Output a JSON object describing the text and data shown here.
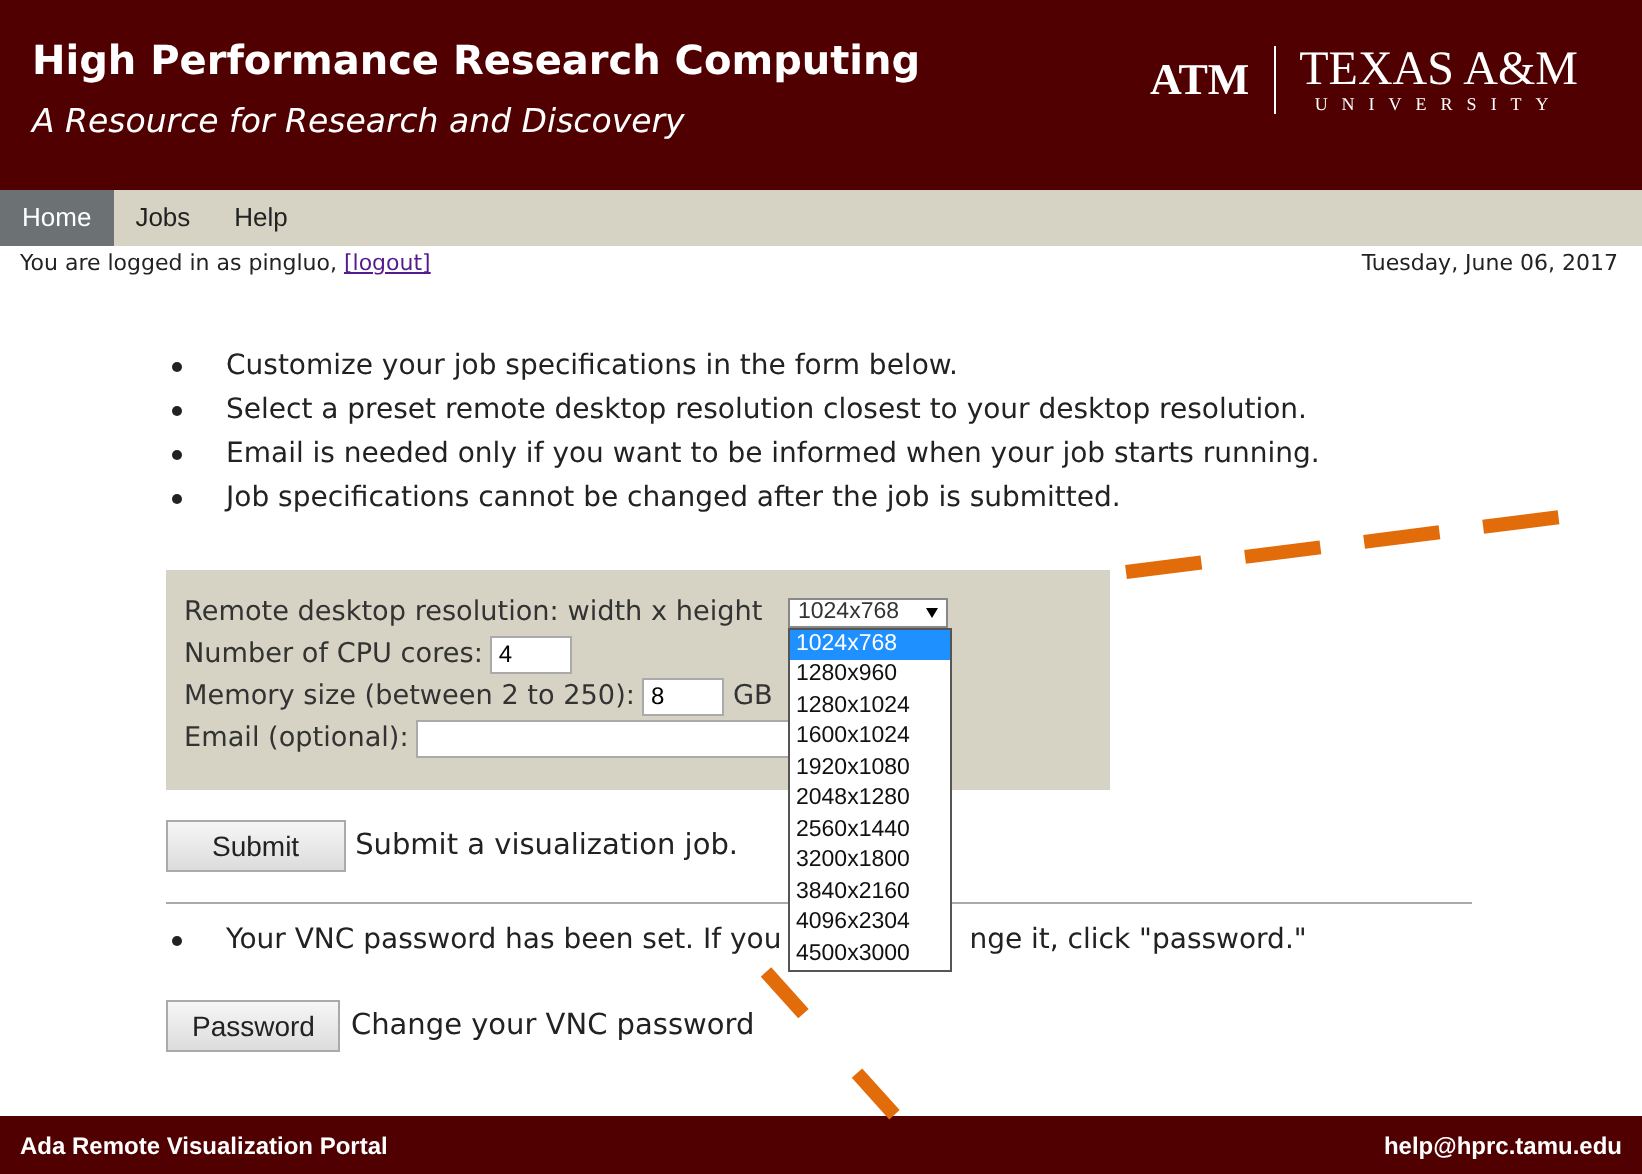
{
  "header": {
    "title": "High Performance Research Computing",
    "subtitle": "A Resource for Research and Discovery",
    "logo_mark": "ATM",
    "logo_name": "TEXAS A&M",
    "logo_sub": "UNIVERSITY"
  },
  "nav": [
    {
      "label": "Home",
      "selected": true
    },
    {
      "label": "Jobs",
      "selected": false
    },
    {
      "label": "Help",
      "selected": false
    }
  ],
  "login": {
    "text": "You are logged in as pingluo,",
    "link": "[logout]",
    "date": "Tuesday, June 06, 2017"
  },
  "instructions": [
    "Customize your job specifications in the form below.",
    "Select a preset remote desktop resolution closest to your desktop resolution.",
    "Email is needed only if you want to be informed when your job starts running.",
    "Job specifications cannot be changed after the job is submitted."
  ],
  "form": {
    "resolution_label": "Remote desktop resolution: width x height",
    "resolution_value": "1024x768",
    "cpu_label": "Number of CPU cores:",
    "cpu_value": "4",
    "memory_label": "Memory size (between 2 to 250):",
    "memory_value": "8",
    "memory_unit": "GB",
    "email_label": "Email (optional):"
  },
  "dropdown_options": [
    {
      "label": "1024x768",
      "selected": true
    },
    {
      "label": "1280x960",
      "selected": false
    },
    {
      "label": "1280x1024",
      "selected": false
    },
    {
      "label": "1600x1024",
      "selected": false
    },
    {
      "label": "1920x1080",
      "selected": false
    },
    {
      "label": "2048x1280",
      "selected": false
    },
    {
      "label": "2560x1440",
      "selected": false
    },
    {
      "label": "3200x1800",
      "selected": false
    },
    {
      "label": "3840x2160",
      "selected": false
    },
    {
      "label": "4096x2304",
      "selected": false
    },
    {
      "label": "4500x3000",
      "selected": false
    }
  ],
  "submit": {
    "button": "Submit",
    "text": "Submit a visualization job."
  },
  "password_note": {
    "before": "Your VNC password has been set. If you",
    "after": "nge it, click \"password.\""
  },
  "password": {
    "button": "Password",
    "text": "Change your VNC password"
  },
  "footer": {
    "left": "Ada Remote Visualization Portal",
    "right": "help@hprc.tamu.edu"
  }
}
